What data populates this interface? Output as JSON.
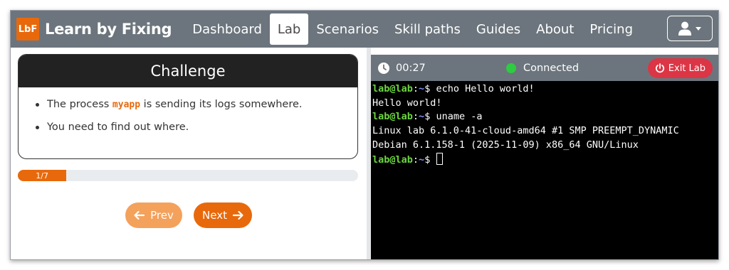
{
  "brand": {
    "logo_text": "LbF",
    "name": "Learn by Fixing",
    "logo_color": "#e8690b"
  },
  "nav": {
    "items": [
      {
        "label": "Dashboard",
        "active": false
      },
      {
        "label": "Lab",
        "active": true
      },
      {
        "label": "Scenarios",
        "active": false
      },
      {
        "label": "Skill paths",
        "active": false
      },
      {
        "label": "Guides",
        "active": false
      },
      {
        "label": "About",
        "active": false
      },
      {
        "label": "Pricing",
        "active": false
      }
    ],
    "user_menu_icon": "user-icon"
  },
  "challenge": {
    "title": "Challenge",
    "bullets": [
      {
        "before": "The process ",
        "code": "myapp",
        "after": " is sending its logs somewhere."
      },
      {
        "text": "You need to find out where."
      }
    ],
    "progress": {
      "label": "1/7",
      "current": 1,
      "total": 7
    },
    "prev_label": "Prev",
    "next_label": "Next"
  },
  "terminal": {
    "timer": "00:27",
    "status": "Connected",
    "exit_label": "Exit Lab",
    "prompt_user": "lab@lab",
    "prompt_path": "~",
    "lines": [
      {
        "type": "prompt",
        "command": "echo Hello world!"
      },
      {
        "type": "output",
        "text": "Hello world!"
      },
      {
        "type": "prompt",
        "command": "uname -a"
      },
      {
        "type": "output",
        "text": "Linux lab 6.1.0-41-cloud-amd64 #1 SMP PREEMPT_DYNAMIC"
      },
      {
        "type": "output",
        "text": "Debian 6.1.158-1 (2025-11-09) x86_64 GNU/Linux"
      },
      {
        "type": "prompt",
        "command": ""
      }
    ]
  },
  "colors": {
    "accent": "#e8690b",
    "navbar": "#6c757d",
    "danger": "#dc3545",
    "success": "#2ecc40"
  }
}
